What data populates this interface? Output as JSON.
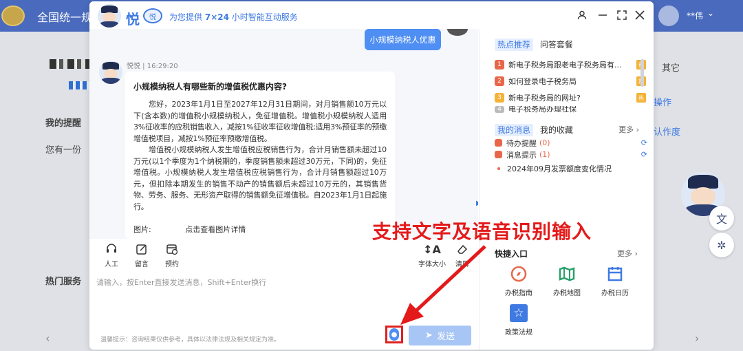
{
  "background": {
    "site_title": "全国统一规",
    "user_name": "**伟",
    "left_texts": [
      "我的提醒",
      "您有一份",
      "热门服务"
    ],
    "right_texts": [
      "其它",
      "操作",
      "认作度"
    ]
  },
  "modal": {
    "logo_text": "悦",
    "logo_badge": "悦",
    "slogan_prefix": "为您提供",
    "slogan_bold": "7×24",
    "slogan_suffix": "小时智能互动服务",
    "window_buttons": [
      "user-icon",
      "minimize-icon",
      "expand-icon",
      "close-icon"
    ]
  },
  "chat": {
    "user_message": "小规模纳税人优惠",
    "bot_meta": "悦悦 | 16:29:20",
    "answer_title": "小规模纳税人有哪些新的增值税优惠内容?",
    "answer_p1": "您好，2023年1月1日至2027年12月31日期间，对月销售额10万元以下(含本数)的增值税小规模纳税人，免征增值税。增值税小规模纳税人适用3%征收率的应税销售收入，减按1%征收率征收增值税;适用3%预征率的预缴增值税项目，减按1%预征率预缴增值税。",
    "answer_p2": "增值税小规模纳税人发生增值税应税销售行为，合计月销售额未超过10万元(以1个季度为1个纳税期的，季度销售额未超过30万元，下同)的，免征增值税。小规模纳税人发生增值税应税销售行为，合计月销售额超过10万元，但扣除本期发生的销售不动产的销售额后未超过10万元的，其销售货物、劳务、服务、无形资产取得的销售额免征增值税。自2023年1月1日起施行。",
    "image_label": "图片:",
    "image_link": "点击查看图片详情"
  },
  "tools": {
    "human": "人工",
    "message": "留言",
    "appointment": "预约",
    "font_size": "字体大小",
    "clear": "清屏"
  },
  "input": {
    "placeholder": "请输入，按Enter直接发送消息，Shift+Enter换行",
    "tip": "温馨提示：咨询结果仅供参考，具体以法律法规及相关规定为准。",
    "send_label": "发送"
  },
  "right_panel": {
    "tab_active": "热点推荐",
    "tab_other": "问答套餐",
    "hot_items": [
      {
        "num": "1",
        "text": "新电子税务局跟老电子税务局有...",
        "color": "#e8674b"
      },
      {
        "num": "2",
        "text": "如何登录电子税务局",
        "color": "#e8674b"
      },
      {
        "num": "3",
        "text": "新电子税务局的网址?",
        "color": "#f4b237"
      },
      {
        "num": "4",
        "text": "电子税务局办理社保",
        "color": "#bbbbbb"
      }
    ],
    "hot_badge": "热",
    "msg_tab_active": "我的消息",
    "msg_tab_other": "我的收藏",
    "more": "更多",
    "messages": [
      {
        "label": "待办提醒",
        "count": "(0)"
      },
      {
        "label": "消息提示",
        "count": "(1)"
      }
    ],
    "notice": "2024年09月发票额度变化情况",
    "quick_title": "快捷入口",
    "quick_more": "更多",
    "quick_items": [
      {
        "label": "办税指南",
        "icon": "compass-icon",
        "color": "#e8674b"
      },
      {
        "label": "办税地图",
        "icon": "map-icon",
        "color": "#2aa06a"
      },
      {
        "label": "办税日历",
        "icon": "calendar-icon",
        "color": "#3f7ae3"
      },
      {
        "label": "政策法规",
        "icon": "policy-icon",
        "color": "#3f7ae3"
      }
    ]
  },
  "annotation": "支持文字及语音识别输入",
  "colors": {
    "accent": "#3f7ae3",
    "annotation_red": "#e41a1a",
    "header_bg": "#4a6bbd"
  }
}
